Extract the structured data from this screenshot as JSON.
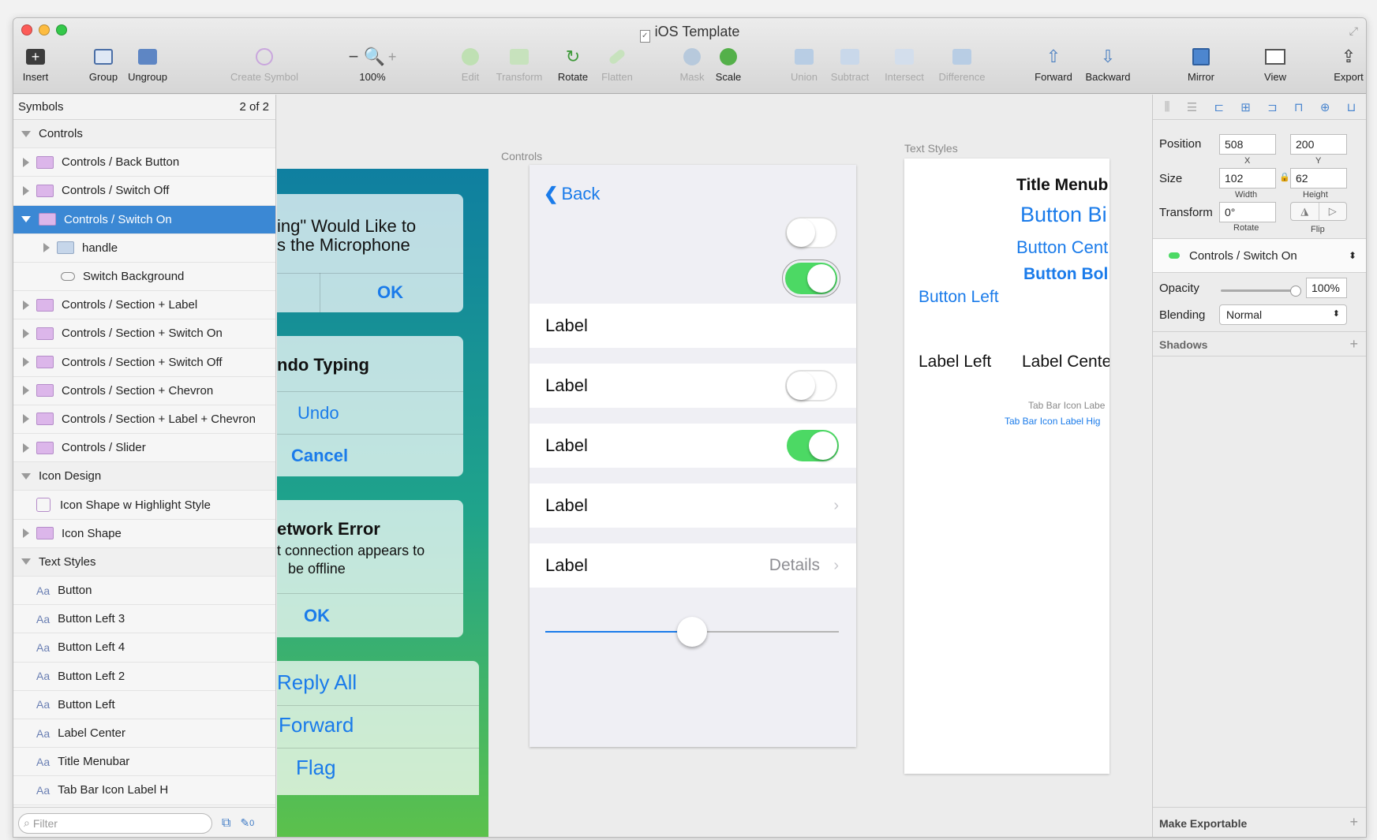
{
  "window": {
    "title": "iOS Template"
  },
  "toolbar": {
    "insert": "Insert",
    "group": "Group",
    "ungroup": "Ungroup",
    "create_symbol": "Create Symbol",
    "zoom": "100%",
    "edit": "Edit",
    "transform": "Transform",
    "rotate": "Rotate",
    "flatten": "Flatten",
    "mask": "Mask",
    "scale": "Scale",
    "union": "Union",
    "subtract": "Subtract",
    "intersect": "Intersect",
    "difference": "Difference",
    "forward": "Forward",
    "backward": "Backward",
    "mirror": "Mirror",
    "view": "View",
    "export": "Export"
  },
  "sidebar": {
    "title": "Symbols",
    "page_count": "2 of 2",
    "items": [
      {
        "label": "Controls"
      },
      {
        "label": "Controls / Back Button"
      },
      {
        "label": "Controls / Switch Off"
      },
      {
        "label": "Controls / Switch On"
      },
      {
        "label": "handle"
      },
      {
        "label": "Switch Background"
      },
      {
        "label": "Controls / Section + Label"
      },
      {
        "label": "Controls / Section + Switch On"
      },
      {
        "label": "Controls / Section + Switch Off"
      },
      {
        "label": "Controls / Section + Chevron"
      },
      {
        "label": "Controls / Section + Label + Chevron"
      },
      {
        "label": "Controls / Slider"
      },
      {
        "label": "Icon Design"
      },
      {
        "label": "Icon Shape w Highlight Style"
      },
      {
        "label": "Icon Shape"
      },
      {
        "label": "Text Styles"
      },
      {
        "label": "Button"
      },
      {
        "label": "Button Left 3"
      },
      {
        "label": "Button Left 4"
      },
      {
        "label": "Button Left 2"
      },
      {
        "label": "Button Left"
      },
      {
        "label": "Label Center"
      },
      {
        "label": "Title Menubar"
      },
      {
        "label": "Tab Bar Icon Label H"
      }
    ],
    "aa": "Aa",
    "filter_placeholder": "Filter",
    "edit_count": "0"
  },
  "canvas": {
    "artboard1": {
      "alert1_line1": "ing\" Would Like to",
      "alert1_line2": "s the Microphone",
      "alert1_ok": "OK",
      "alert2_title": "ndo Typing",
      "alert2_undo": "Undo",
      "alert2_cancel": "Cancel",
      "alert3_title": "etwork Error",
      "alert3_line1": "t connection appears to",
      "alert3_line2": "be offline",
      "alert3_ok": "OK",
      "action1": "Reply All",
      "action2": "Forward",
      "action3": "Flag"
    },
    "controls": {
      "artboard_label": "Controls",
      "back": "Back",
      "row1": "Label",
      "row2": "Label",
      "row3": "Label",
      "row4": "Label",
      "row5": "Label",
      "row5_detail": "Details",
      "slider_value": 0.5
    },
    "text_styles": {
      "artboard_label": "Text Styles",
      "title_menubar": "Title Menub",
      "button_big": "Button Bi",
      "button_center": "Button Cent",
      "button_bold": "Button Bol",
      "button_left": "Button Left",
      "label_left": "Label Left",
      "label_center": "Label Cente",
      "tab_bar_label": "Tab Bar Icon Labe",
      "tab_bar_highlight": "Tab Bar Icon Label Hig"
    }
  },
  "inspector": {
    "position_label": "Position",
    "x": "508",
    "y": "200",
    "x_label": "X",
    "y_label": "Y",
    "size_label": "Size",
    "width": "102",
    "height": "62",
    "width_label": "Width",
    "height_label": "Height",
    "transform_label": "Transform",
    "rotate": "0°",
    "rotate_label": "Rotate",
    "flip_label": "Flip",
    "symbol": "Controls / Switch On",
    "opacity_label": "Opacity",
    "opacity": "100%",
    "blending_label": "Blending",
    "blending": "Normal",
    "shadows_label": "Shadows",
    "make_exportable": "Make Exportable"
  },
  "colors": {
    "accent": "#3b88d4",
    "ios_blue": "#1a7bea",
    "switch_green": "#4cd964"
  }
}
